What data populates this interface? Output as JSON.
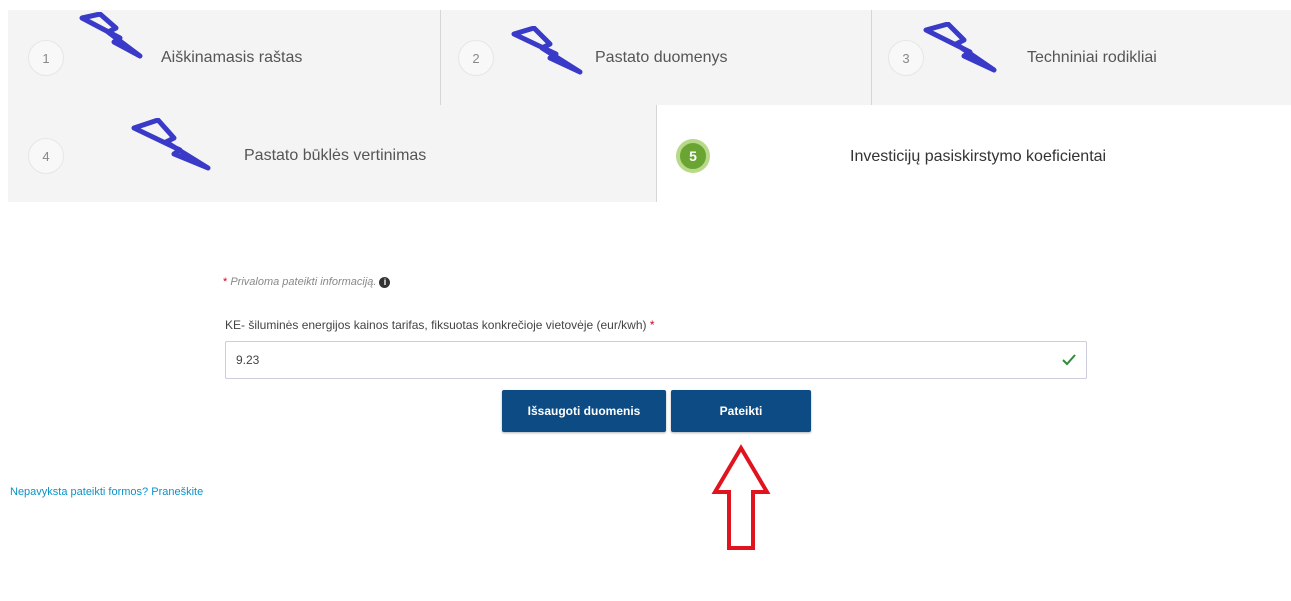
{
  "steps": [
    {
      "number": "1",
      "label": "Aiškinamasis raštas",
      "active": false
    },
    {
      "number": "2",
      "label": "Pastato duomenys",
      "active": false
    },
    {
      "number": "3",
      "label": "Techniniai rodikliai",
      "active": false
    },
    {
      "number": "4",
      "label": "Pastato būklės vertinimas",
      "active": false
    },
    {
      "number": "5",
      "label": "Investicijų pasiskirstymo koeficientai",
      "active": true
    }
  ],
  "form": {
    "required_star": "*",
    "required_note": "Privaloma pateikti informaciją.",
    "info_icon": "i",
    "field_label": "KE- šiluminės energijos kainos tarifas, fiksuotas konkrečioje vietovėje (eur/kwh)",
    "field_star": "*",
    "field_value": "9.23"
  },
  "buttons": {
    "save_label": "Išsaugoti duomenis",
    "submit_label": "Pateikti"
  },
  "report_link": "Nepavyksta pateikti formos? Praneškite",
  "colors": {
    "primary_button": "#0d4b84",
    "active_step": "#6aa534",
    "link": "#0a93c8",
    "required": "#d0021b",
    "annotation_bolt": "#3a3ac8",
    "annotation_arrow": "#e0141e"
  },
  "annotations": {
    "bolt_icons": "lightning-bolt-icon",
    "arrow": "up-arrow-icon"
  }
}
